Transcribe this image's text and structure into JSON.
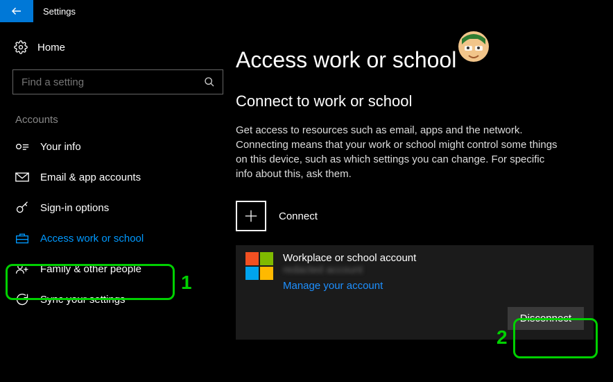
{
  "titlebar": {
    "app_name": "Settings"
  },
  "sidebar": {
    "home_label": "Home",
    "search_placeholder": "Find a setting",
    "section_label": "Accounts",
    "items": [
      {
        "label": "Your info"
      },
      {
        "label": "Email & app accounts"
      },
      {
        "label": "Sign-in options"
      },
      {
        "label": "Access work or school"
      },
      {
        "label": "Family & other people"
      },
      {
        "label": "Sync your settings"
      }
    ]
  },
  "main": {
    "heading": "Access work or school",
    "subheading": "Connect to work or school",
    "description": "Get access to resources such as email, apps and the network. Connecting means that your work or school might control some things on this device, such as which settings you can change. For specific info about this, ask them.",
    "connect_label": "Connect",
    "account": {
      "title": "Workplace or school account",
      "detail": "redacted account",
      "manage_link": "Manage your account",
      "disconnect_label": "Disconnect"
    }
  },
  "annotations": {
    "num1": "1",
    "num2": "2"
  }
}
